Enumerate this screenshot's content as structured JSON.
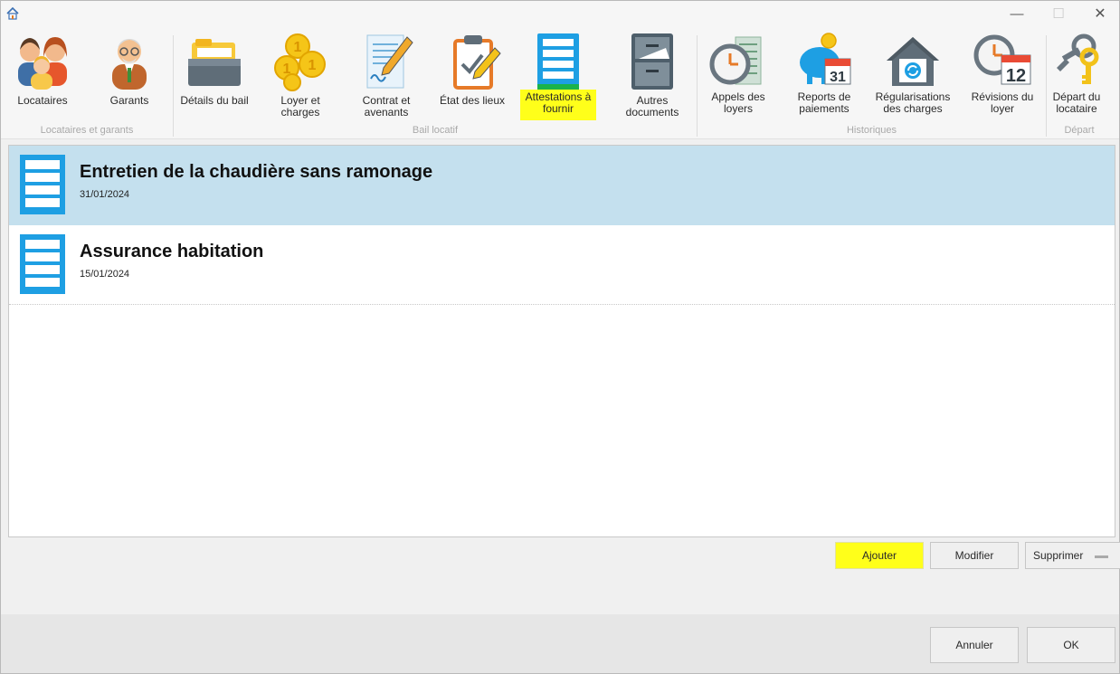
{
  "window": {
    "app_icon": "house-icon",
    "controls": {
      "minimize": "—",
      "maximize": "☐",
      "close": "✕"
    }
  },
  "ribbon": {
    "groups": [
      {
        "label": "Locataires et garants"
      },
      {
        "label": "Bail locatif"
      },
      {
        "label": "Historiques"
      },
      {
        "label": "Départ"
      }
    ],
    "buttons": [
      {
        "label": "Locataires",
        "icon": "tenants-icon"
      },
      {
        "label": "Garants",
        "icon": "guarantor-icon"
      },
      {
        "label": "Détails du bail",
        "icon": "folder-icon"
      },
      {
        "label": "Loyer et\ncharges",
        "icon": "coins-icon"
      },
      {
        "label": "Contrat et\navenants",
        "icon": "contract-icon"
      },
      {
        "label": "État des lieux",
        "icon": "checklist-icon"
      },
      {
        "label": "Attestations à\nfournir",
        "icon": "attestation-icon",
        "highlighted": true
      },
      {
        "label": "Autres\ndocuments",
        "icon": "cabinet-icon"
      },
      {
        "label": "Appels des\nloyers",
        "icon": "rent-call-icon"
      },
      {
        "label": "Reports de\npaiements",
        "icon": "piggy-calendar-icon",
        "calendar_day": "31"
      },
      {
        "label": "Régularisations\ndes charges",
        "icon": "house-regularization-icon"
      },
      {
        "label": "Révisions du\nloyer",
        "icon": "clock-calendar-icon",
        "calendar_day": "12"
      },
      {
        "label": "Départ du\nlocataire",
        "icon": "keys-icon"
      }
    ]
  },
  "attestations": [
    {
      "title": "Entretien de la chaudière sans ramonage",
      "date": "31/01/2024",
      "selected": true
    },
    {
      "title": "Assurance habitation",
      "date": "15/01/2024",
      "selected": false
    }
  ],
  "actions": {
    "add": "Ajouter",
    "edit": "Modifier",
    "delete": "Supprimer"
  },
  "dialog": {
    "cancel": "Annuler",
    "ok": "OK"
  },
  "colors": {
    "highlight": "#ffff1a",
    "selection": "#c4e0ee",
    "doc_blue": "#1e9fe3"
  }
}
